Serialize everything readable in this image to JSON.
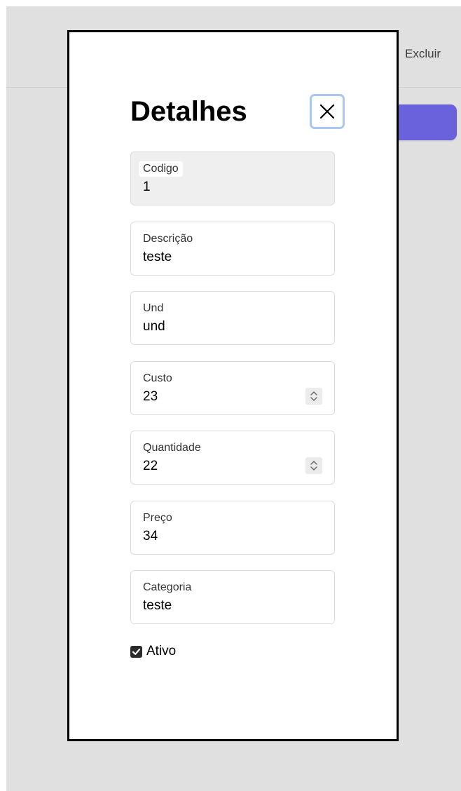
{
  "background": {
    "header_action_label": "Excluir"
  },
  "modal": {
    "title": "Detalhes",
    "close_icon": "close-icon",
    "fields": {
      "codigo": {
        "label": "Codigo",
        "value": "1",
        "disabled": true
      },
      "descricao": {
        "label": "Descrição",
        "value": "teste"
      },
      "und": {
        "label": "Und",
        "value": "und"
      },
      "custo": {
        "label": "Custo",
        "value": "23",
        "icon": "spinner-icon"
      },
      "quantidade": {
        "label": "Quantidade",
        "value": "22",
        "icon": "spinner-icon"
      },
      "preco": {
        "label": "Preço",
        "value": "34"
      },
      "categoria": {
        "label": "Categoria",
        "value": "teste"
      }
    },
    "ativo": {
      "label": "Ativo",
      "checked": true
    }
  },
  "colors": {
    "accent": "#6a62dc",
    "focus_ring": "#a9c6f4",
    "backdrop": "#e0e0e0",
    "disabled_field": "#efefef"
  }
}
